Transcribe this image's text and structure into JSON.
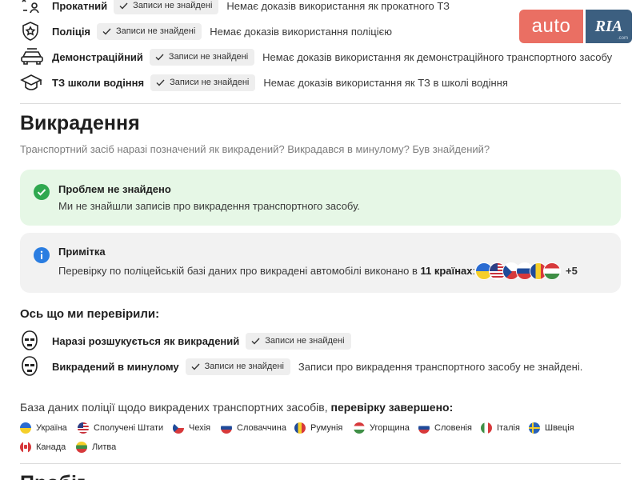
{
  "usage": {
    "rows": [
      {
        "label": "Прокатний",
        "chip": "Записи не знайдені",
        "desc": "Немає доказів використання як прокатного ТЗ",
        "icon": "rental-icon"
      },
      {
        "label": "Поліція",
        "chip": "Записи не знайдені",
        "desc": "Немає доказів використання поліцією",
        "icon": "police-badge-icon"
      },
      {
        "label": "Демонстраційний",
        "chip": "Записи не знайдені",
        "desc": "Немає доказів використання як демонстраційного транспортного засобу",
        "icon": "demo-car-icon"
      },
      {
        "label": "ТЗ школи водіння",
        "chip": "Записи не знайдені",
        "desc": "Немає доказів використання як ТЗ в школі водіння",
        "icon": "graduation-cap-icon"
      }
    ]
  },
  "logo": {
    "auto": "auto",
    "ria": "RIA",
    "domain": ".com"
  },
  "theft": {
    "title": "Викрадення",
    "subtitle": "Транспортний засіб наразі позначений як викрадений? Викрадався в минулому? Був знайдений?",
    "ok_alert": {
      "title": "Проблем не знайдено",
      "text": "Ми не знайшли записів про викрадення транспортного засобу."
    },
    "note": {
      "title": "Примітка",
      "text_before": "Перевірку по поліцейській базі даних про викрадені автомобілі виконано в ",
      "countries_count": "11 країнах",
      "text_after": ":",
      "more": "+5"
    },
    "checked_title": "Ось що ми перевірили:",
    "checks": [
      {
        "label": "Наразі розшукується як викрадений",
        "chip": "Записи не знайдені",
        "desc": ""
      },
      {
        "label": "Викрадений в минулому",
        "chip": "Записи не знайдені",
        "desc": "Записи про викрадення транспортного засобу не знайдені."
      }
    ],
    "db_text": "База даних поліції щодо викрадених транспортних засобів, ",
    "db_bold": "перевірку завершено:",
    "countries": [
      "Україна",
      "Сполучені Штати",
      "Чехія",
      "Словаччина",
      "Румунія",
      "Угорщина",
      "Словенія",
      "Італія",
      "Швеція",
      "Канада",
      "Литва"
    ]
  },
  "next_section_title": "Пробіг",
  "colors": {
    "ok_bg": "#e6f7e6",
    "ok_icon": "#2fa84f",
    "note_bg": "#f2f2f2",
    "info_icon": "#2a7de1",
    "logo_auto": "#ea6f63",
    "logo_ria": "#3c5f80"
  }
}
